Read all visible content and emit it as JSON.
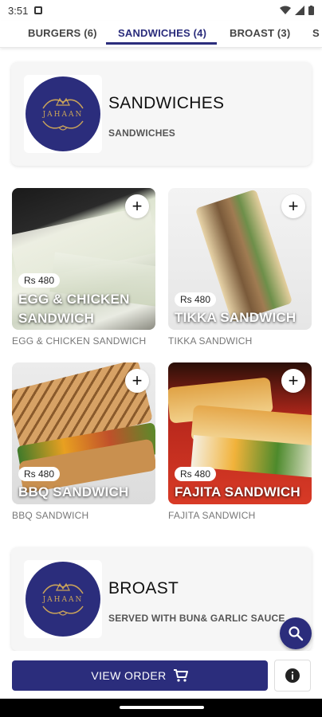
{
  "status_bar": {
    "time": "3:51"
  },
  "tabs": [
    {
      "label": ""
    },
    {
      "label": "BURGERS (6)"
    },
    {
      "label": "SANDWICHES (4)"
    },
    {
      "label": "BROAST (3)"
    },
    {
      "label": "S"
    }
  ],
  "active_tab_index": 2,
  "logo": {
    "text_top": "JAHAAN"
  },
  "sandwiches_section": {
    "title": "SANDWICHES",
    "subtitle": "SANDWICHES",
    "items": [
      {
        "name": "EGG & CHICKEN SANDWICH",
        "price": "Rs 480",
        "caption": "EGG & CHICKEN SANDWICH"
      },
      {
        "name": "TIKKA SANDWICH",
        "price": "Rs 480",
        "caption": "TIKKA SANDWICH"
      },
      {
        "name": "BBQ SANDWICH",
        "price": "Rs 480",
        "caption": "BBQ SANDWICH"
      },
      {
        "name": "FAJITA SANDWICH",
        "price": "Rs 480",
        "caption": "FAJITA SANDWICH"
      }
    ]
  },
  "broast_section": {
    "title": "BROAST",
    "subtitle": "SERVED WITH BUN& GARLIC SAUCE"
  },
  "bottom_bar": {
    "view_order_label": "VIEW ORDER"
  },
  "icons": {
    "add": "plus-icon",
    "search": "search-icon",
    "cart": "cart-icon",
    "info": "info-icon"
  },
  "colors": {
    "brand": "#2b2d7c",
    "logo_gold": "#c9a35a"
  }
}
